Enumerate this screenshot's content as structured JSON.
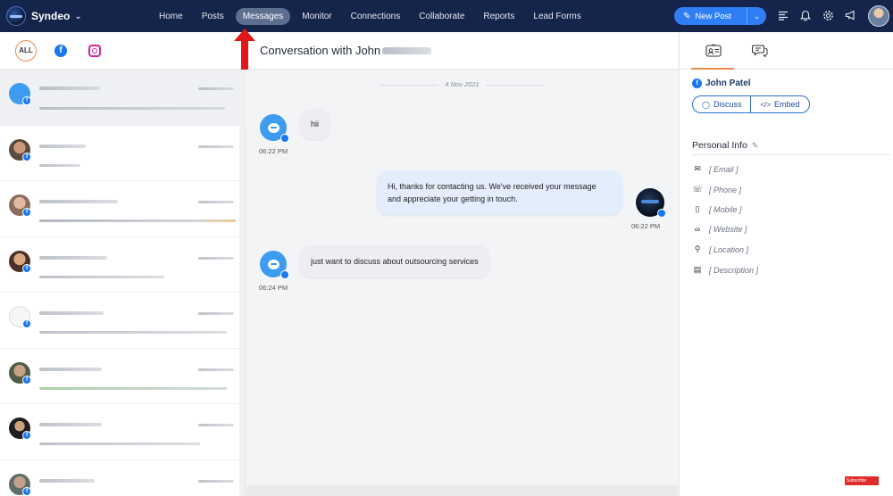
{
  "brand": {
    "name": "Syndeo"
  },
  "nav": {
    "links": [
      "Home",
      "Posts",
      "Messages",
      "Monitor",
      "Connections",
      "Collaborate",
      "Reports",
      "Lead Forms"
    ],
    "active": "Messages"
  },
  "new_post": {
    "label": "New Post"
  },
  "top_icons": [
    "menu-lines-icon",
    "bell-icon",
    "gear-icon",
    "megaphone-icon"
  ],
  "filters": {
    "all_label": "ALL",
    "facebook_icon": "facebook-icon",
    "instagram_icon": "instagram-icon"
  },
  "conversation": {
    "title_prefix": "Conversation with John",
    "date": "4 Nov 2021",
    "messages": [
      {
        "direction": "in",
        "text": "hii",
        "time": "06:22 PM"
      },
      {
        "direction": "out",
        "text_line1": "Hi, thanks for contacting us. We've received your message",
        "text_line2": "and appreciate your getting in touch.",
        "time": "06:22 PM"
      },
      {
        "direction": "in",
        "text": "just want to discuss about outsourcing services",
        "time": "06:24 PM"
      }
    ]
  },
  "contact": {
    "name": "John Patel",
    "discuss_label": "Discuss",
    "embed_label": "Embed",
    "personal_info_title": "Personal Info",
    "fields": [
      "[ Email ]",
      "[ Phone ]",
      "[ Mobile ]",
      "[ Website ]",
      "[ Location ]",
      "[ Description ]"
    ]
  },
  "youtube_badge": "Subscribe",
  "colors": {
    "nav_bg": "#15244a",
    "accent": "#2f7ef5",
    "highlight": "#f08a4b",
    "facebook": "#1877f2",
    "annotation_arrow": "#e01818"
  }
}
